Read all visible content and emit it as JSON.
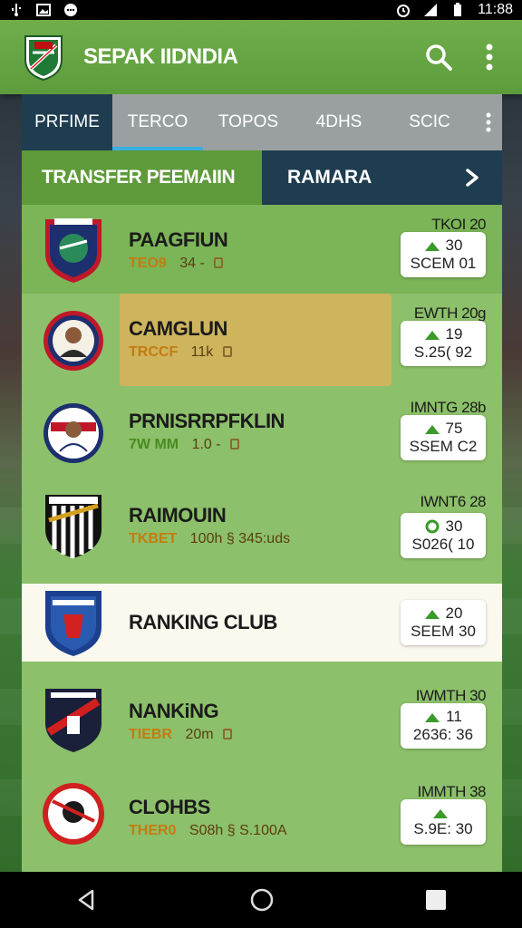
{
  "status_bar": {
    "time": "11:88"
  },
  "app_bar": {
    "title": "SEPAK IIDNDIA"
  },
  "tabs": [
    {
      "label": "PRFIME"
    },
    {
      "label": "TERCO"
    },
    {
      "label": "TOPOS"
    },
    {
      "label": "4DHS"
    },
    {
      "label": "SCIC"
    }
  ],
  "section": {
    "left_title": "TRANSFER PEEMAIIN",
    "right_title": "RAMARA"
  },
  "rows": [
    {
      "name": "PAAGFIUN",
      "tag": "TEO9",
      "meta": "34 -",
      "date": "TKOI 20",
      "stat_value": "30",
      "stat_label": "SCEM 01"
    },
    {
      "name": "CAMGLUN",
      "tag": "TRCCF",
      "meta": "11k",
      "date": "EWTH 20g",
      "stat_value": "19",
      "stat_label": "S.25( 92"
    },
    {
      "name": "PRNISRRPFKLIN",
      "tag": "7W MM",
      "meta": "1.0 -",
      "date": "IMNTG 28b",
      "stat_value": "75",
      "stat_label": "SSEM C2"
    },
    {
      "name": "RAIMOUIN",
      "tag": "TKBET",
      "meta": "100h  § 345:uds",
      "date": "IWNT6 28",
      "stat_value": "30",
      "stat_label": "S026( 10"
    },
    {
      "name": "RANKING CLUB",
      "tag": "",
      "meta": "",
      "date": "",
      "stat_value": "20",
      "stat_label": "SEEM 30"
    },
    {
      "name": "NANKiNG",
      "tag": "TIEBR",
      "meta": "20m",
      "date": "IWMTH 30",
      "stat_value": "11",
      "stat_label": "2636: 36"
    },
    {
      "name": "CLOHBS",
      "tag": "THER0",
      "meta": "S08h  § S.100A",
      "date": "IMMTH 38",
      "stat_value": "",
      "stat_label": "S.9E: 30"
    }
  ],
  "colors": {
    "primary_green": "#5e9a3a",
    "dark_navy": "#1f3d50",
    "list_green": "#8cc06a",
    "accent_blue": "#3ab0e0",
    "highlight": "#e4b05a"
  }
}
